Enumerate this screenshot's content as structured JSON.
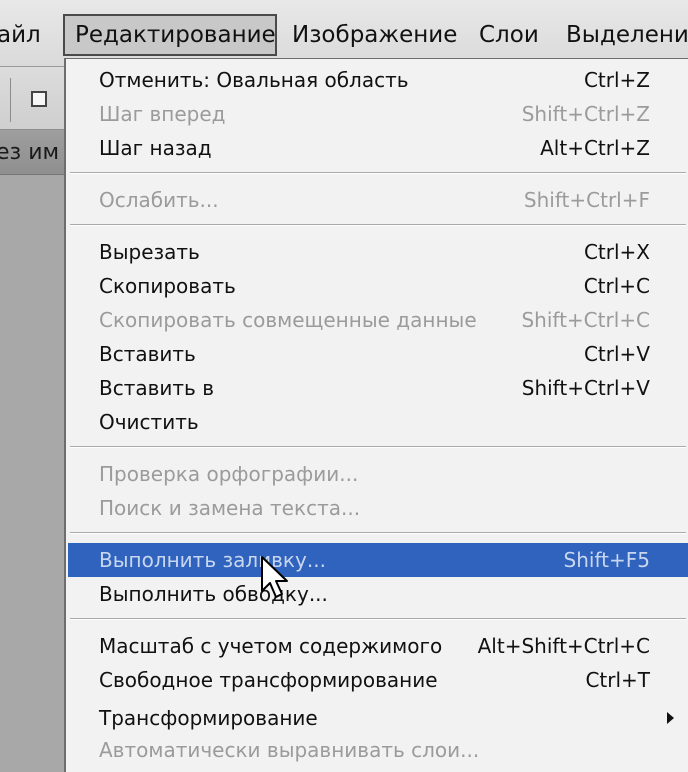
{
  "menubar": {
    "items": [
      "айл",
      "Редактирование",
      "Изображение",
      "Слои",
      "Выделение"
    ],
    "active_index": 1
  },
  "document_tab": {
    "label": "ез им"
  },
  "edit_menu": {
    "items": [
      {
        "label": "Отменить: Овальная область",
        "shortcut": "Ctrl+Z",
        "enabled": true
      },
      {
        "label": "Шаг вперед",
        "shortcut": "Shift+Ctrl+Z",
        "enabled": false
      },
      {
        "label": "Шаг назад",
        "shortcut": "Alt+Ctrl+Z",
        "enabled": true
      },
      {
        "label": "Ослабить...",
        "shortcut": "Shift+Ctrl+F",
        "enabled": false
      },
      {
        "label": "Вырезать",
        "shortcut": "Ctrl+X",
        "enabled": true
      },
      {
        "label": "Скопировать",
        "shortcut": "Ctrl+C",
        "enabled": true
      },
      {
        "label": "Скопировать совмещенные данные",
        "shortcut": "Shift+Ctrl+C",
        "enabled": false
      },
      {
        "label": "Вставить",
        "shortcut": "Ctrl+V",
        "enabled": true
      },
      {
        "label": "Вставить в",
        "shortcut": "Shift+Ctrl+V",
        "enabled": true
      },
      {
        "label": "Очистить",
        "shortcut": "",
        "enabled": true
      },
      {
        "label": "Проверка орфографии...",
        "shortcut": "",
        "enabled": false
      },
      {
        "label": "Поиск и замена текста...",
        "shortcut": "",
        "enabled": false
      },
      {
        "label": "Выполнить заливку...",
        "shortcut": "Shift+F5",
        "enabled": true,
        "highlighted": true
      },
      {
        "label": "Выполнить обводку...",
        "shortcut": "",
        "enabled": true
      },
      {
        "label": "Масштаб с учетом содержимого",
        "shortcut": "Alt+Shift+Ctrl+C",
        "enabled": true
      },
      {
        "label": "Свободное трансформирование",
        "shortcut": "Ctrl+T",
        "enabled": true
      },
      {
        "label": "Трансформирование",
        "shortcut": "",
        "enabled": true,
        "submenu": true
      },
      {
        "label": "Автоматически выравнивать слои...",
        "shortcut": "",
        "enabled": false
      }
    ]
  },
  "colors": {
    "highlight": "#2f63bd",
    "menu_background": "#f2f2f2",
    "disabled_text": "#9b9b9b"
  }
}
